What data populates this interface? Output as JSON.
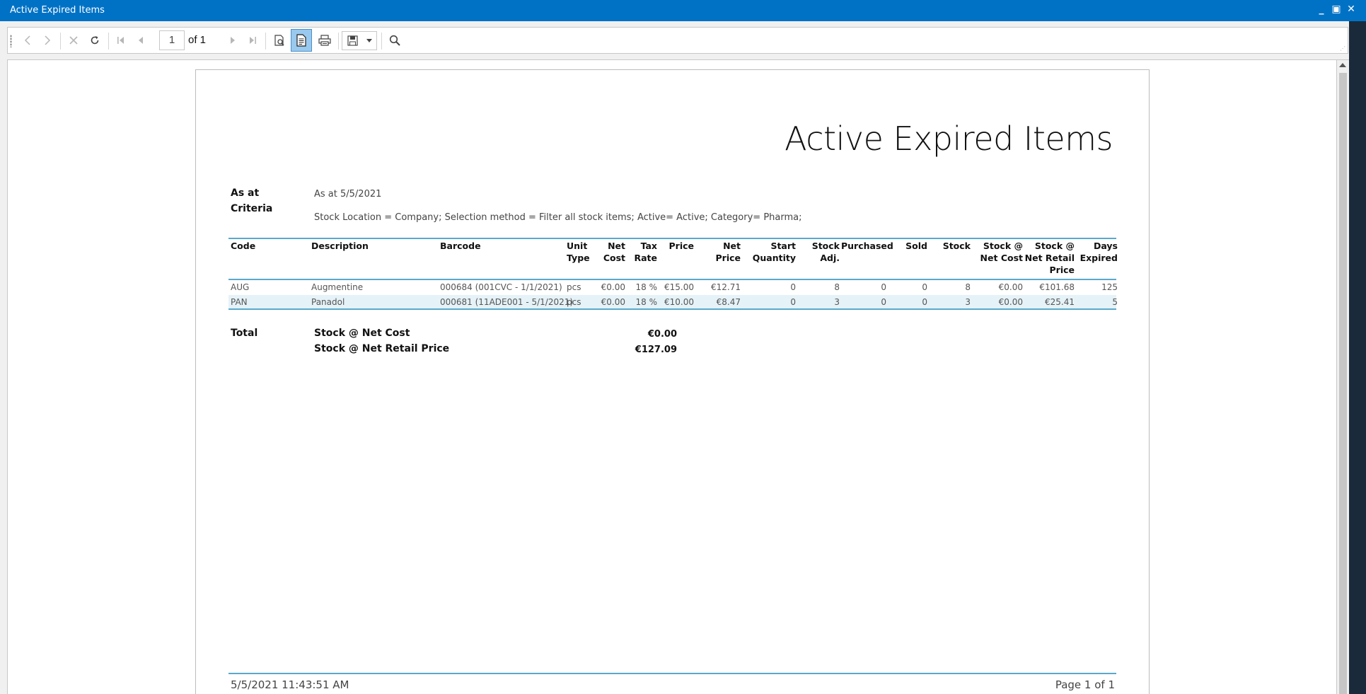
{
  "window": {
    "title": "Active Expired Items",
    "controls": [
      "_",
      "▣",
      "✕"
    ]
  },
  "toolbar": {
    "icons": [
      "previous-icon",
      "next-icon",
      "stop-icon",
      "refresh-icon",
      "first-page-icon",
      "previous-page-icon",
      "next-page-icon",
      "last-page-icon",
      "print-layout-icon",
      "page-setup-icon",
      "print-icon",
      "save-icon",
      "dropdown-icon",
      "find-icon"
    ],
    "page_number": "1",
    "page_of": "of 1"
  },
  "report": {
    "title": "Active Expired Items",
    "as_at_label": "As at",
    "as_at_value": "As at 5/5/2021",
    "criteria_label": "Criteria",
    "criteria_value": "Stock Location = Company; Selection method = Filter all stock items; Active= Active; Category= Pharma;",
    "columns": [
      {
        "label": "Code"
      },
      {
        "label": "Description"
      },
      {
        "label": "Barcode"
      },
      {
        "label": "Unit\nType"
      },
      {
        "label": "Net\nCost"
      },
      {
        "label": "Tax\nRate"
      },
      {
        "label": "Price"
      },
      {
        "label": "Net Price"
      },
      {
        "label": "Start\nQuantity"
      },
      {
        "label": "Stock\nAdj."
      },
      {
        "label": "Purchased"
      },
      {
        "label": "Sold"
      },
      {
        "label": "Stock"
      },
      {
        "label": "Stock @\nNet Cost"
      },
      {
        "label": "Stock @\nNet Retail\nPrice"
      },
      {
        "label": "Days\nExpired"
      }
    ],
    "rows": [
      [
        "AUG",
        "Augmentine",
        "000684 (001CVC - 1/1/2021)",
        "pcs",
        "€0.00",
        "18 %",
        "€15.00",
        "€12.71",
        "0",
        "8",
        "0",
        "0",
        "8",
        "€0.00",
        "€101.68",
        "125"
      ],
      [
        "PAN",
        "Panadol",
        "000681 (11ADE001 - 5/1/2021)",
        "pcs",
        "€0.00",
        "18 %",
        "€10.00",
        "€8.47",
        "0",
        "3",
        "0",
        "0",
        "3",
        "€0.00",
        "€25.41",
        "5"
      ]
    ],
    "totals": {
      "label": "Total",
      "net_cost_label": "Stock @ Net Cost",
      "net_cost_value": "€0.00",
      "net_retail_label": "Stock @ Net Retail Price",
      "net_retail_value": "€127.09"
    },
    "footer": {
      "timestamp": "5/5/2021 11:43:51 AM",
      "page": "Page 1 of 1"
    }
  }
}
